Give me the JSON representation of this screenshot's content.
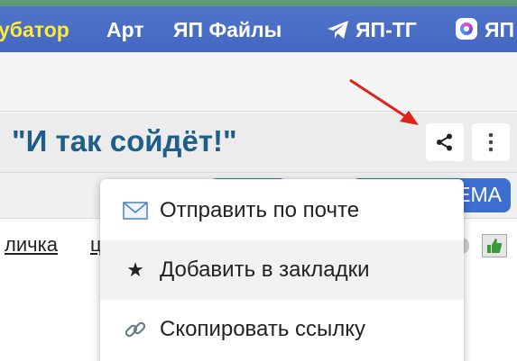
{
  "nav": {
    "items": [
      {
        "label": "убатор",
        "highlight": true
      },
      {
        "label": "Арт"
      },
      {
        "label": "ЯП Файлы"
      },
      {
        "label": "ЯП-ТГ",
        "icon": "telegram-icon"
      },
      {
        "label": "ЯП",
        "icon": "app-logo-icon"
      }
    ]
  },
  "page": {
    "title": "\"И так сойдёт!\""
  },
  "tabs": {
    "right_pill_label": "ЕМА"
  },
  "links": {
    "items": [
      "личка",
      "ц"
    ]
  },
  "share_menu": {
    "items": [
      {
        "label": "Отправить по почте",
        "icon": "envelope-icon"
      },
      {
        "label": "Добавить в закладки",
        "icon": "star-icon"
      },
      {
        "label": "Скопировать ссылку",
        "icon": "link-icon"
      }
    ]
  },
  "colors": {
    "nav_bg": "#4f74c9",
    "nav_highlight": "#ffe936",
    "title_text": "#1e5f8a",
    "pill_blue": "#3c6fd2",
    "annotation_arrow": "#e0201b"
  }
}
